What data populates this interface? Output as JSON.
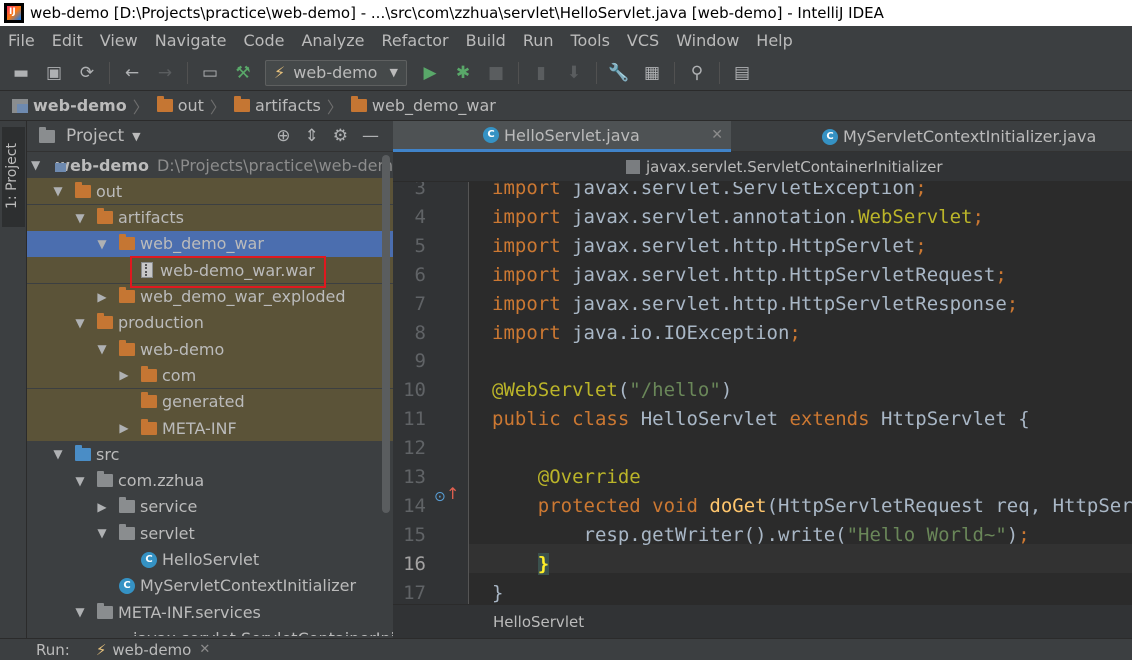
{
  "window": {
    "title": "web-demo [D:\\Projects\\practice\\web-demo] - ...\\src\\com\\zzhua\\servlet\\HelloServlet.java [web-demo] - IntelliJ IDEA"
  },
  "menu": [
    "File",
    "Edit",
    "View",
    "Navigate",
    "Code",
    "Analyze",
    "Refactor",
    "Build",
    "Run",
    "Tools",
    "VCS",
    "Window",
    "Help"
  ],
  "toolbar": {
    "run_config": "web-demo"
  },
  "breadcrumb": [
    "web-demo",
    "out",
    "artifacts",
    "web_demo_war"
  ],
  "stripe": {
    "project_label": "1: Project"
  },
  "project_panel": {
    "title": "Project",
    "tree": [
      {
        "label": "web-demo",
        "hint": "D:\\Projects\\practice\\web-demo",
        "icon": "module-icon",
        "arrow": "▼",
        "bold": true
      },
      {
        "label": "out",
        "icon": "folder-icon",
        "arrow": "▼"
      },
      {
        "label": "artifacts",
        "icon": "folder-icon",
        "arrow": "▼"
      },
      {
        "label": "web_demo_war",
        "icon": "folder-icon",
        "arrow": "▼",
        "selected": true
      },
      {
        "label": "web-demo_war.war",
        "icon": "war-file-icon",
        "arrow": ""
      },
      {
        "label": "web_demo_war_exploded",
        "icon": "folder-icon",
        "arrow": "▶"
      },
      {
        "label": "production",
        "icon": "folder-icon",
        "arrow": "▼"
      },
      {
        "label": "web-demo",
        "icon": "folder-icon",
        "arrow": "▼"
      },
      {
        "label": "com",
        "icon": "folder-icon",
        "arrow": "▶"
      },
      {
        "label": "generated",
        "icon": "folder-icon",
        "arrow": ""
      },
      {
        "label": "META-INF",
        "icon": "folder-icon",
        "arrow": "▶"
      },
      {
        "label": "src",
        "icon": "source-folder-icon",
        "arrow": "▼"
      },
      {
        "label": "com.zzhua",
        "icon": "package-icon",
        "arrow": "▼"
      },
      {
        "label": "service",
        "icon": "package-icon",
        "arrow": "▶"
      },
      {
        "label": "servlet",
        "icon": "package-icon",
        "arrow": "▼"
      },
      {
        "label": "HelloServlet",
        "icon": "class-icon",
        "arrow": ""
      },
      {
        "label": "MyServletContextInitializer",
        "icon": "class-icon",
        "arrow": ""
      },
      {
        "label": "META-INF.services",
        "icon": "package-icon",
        "arrow": "▼"
      },
      {
        "label": "javax.servlet.ServletContainerInitia...",
        "icon": "file-icon",
        "arrow": ""
      }
    ]
  },
  "editor": {
    "tabs": [
      {
        "label": "HelloServlet.java",
        "active": true
      },
      {
        "label": "MyServletContextInitializer.java",
        "active": false
      }
    ],
    "crumb": "javax.servlet.ServletContainerInitializer",
    "current_line": "16",
    "line_numbers": [
      "3",
      "4",
      "5",
      "6",
      "7",
      "8",
      "9",
      "10",
      "11",
      "12",
      "13",
      "14",
      "15",
      "16",
      "17"
    ],
    "code": [
      "import javax.servlet.ServletException;",
      "import javax.servlet.annotation.WebServlet;",
      "import javax.servlet.http.HttpServlet;",
      "import javax.servlet.http.HttpServletRequest;",
      "import javax.servlet.http.HttpServletResponse;",
      "import java.io.IOException;",
      "",
      "@WebServlet(\"/hello\")",
      "public class HelloServlet extends HttpServlet {",
      "",
      "    @Override",
      "    protected void doGet(HttpServletRequest req, HttpServletResponse resp) {",
      "        resp.getWriter().write(\"Hello World~\");",
      "    }",
      "}"
    ],
    "status": "HelloServlet"
  },
  "run_bar": {
    "label": "Run:",
    "tab": "web-demo"
  },
  "colors": {
    "selection": "#4b6eaf",
    "excluded": "#5b5338",
    "keyword": "#cc7832",
    "string": "#6a8759",
    "annotation": "#bbb529",
    "highlight_box": "#e0181f"
  }
}
